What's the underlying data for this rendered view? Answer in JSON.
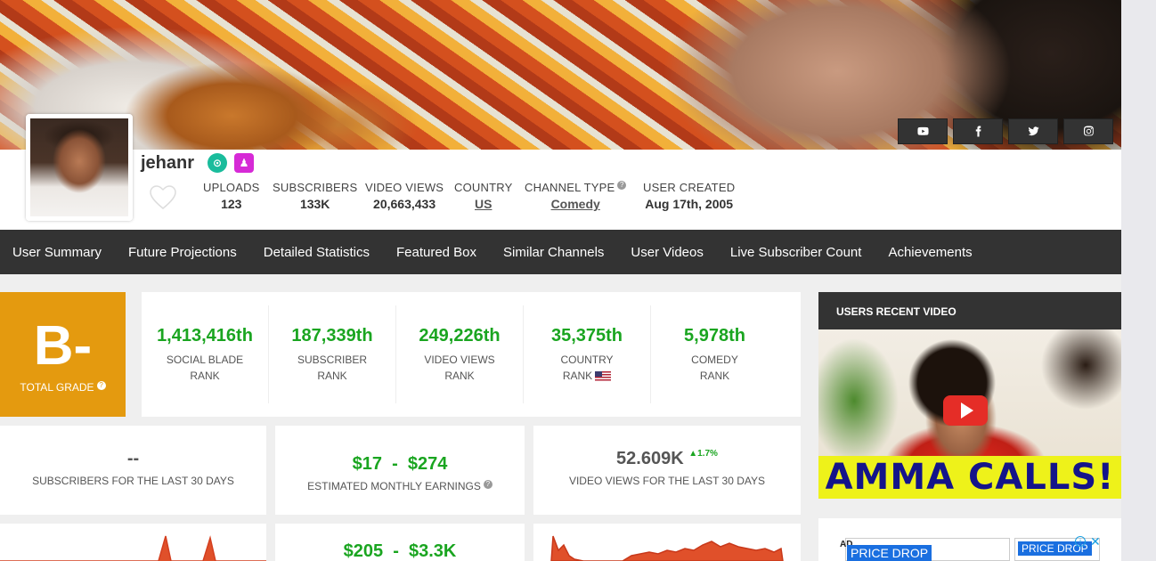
{
  "channel": {
    "username": "jehanr",
    "stats": [
      {
        "label": "UPLOADS",
        "value": "123"
      },
      {
        "label": "SUBSCRIBERS",
        "value": "133K"
      },
      {
        "label": "VIDEO VIEWS",
        "value": "20,663,433"
      },
      {
        "label": "COUNTRY",
        "value": "US"
      },
      {
        "label": "CHANNEL TYPE",
        "value": "Comedy"
      },
      {
        "label": "USER CREATED",
        "value": "Aug 17th, 2005"
      }
    ]
  },
  "social": [
    "youtube-icon",
    "facebook-icon",
    "twitter-icon",
    "instagram-icon"
  ],
  "nav": [
    "User Summary",
    "Future Projections",
    "Detailed Statistics",
    "Featured Box",
    "Similar Channels",
    "User Videos",
    "Live Subscriber Count",
    "Achievements"
  ],
  "grade": {
    "letter": "B-",
    "label": "TOTAL GRADE"
  },
  "ranks": [
    {
      "value": "1,413,416th",
      "line1": "SOCIAL BLADE",
      "line2": "RANK"
    },
    {
      "value": "187,339th",
      "line1": "SUBSCRIBER",
      "line2": "RANK"
    },
    {
      "value": "249,226th",
      "line1": "VIDEO VIEWS",
      "line2": "RANK"
    },
    {
      "value": "35,375th",
      "line1": "COUNTRY",
      "line2": "RANK"
    },
    {
      "value": "5,978th",
      "line1": "COMEDY",
      "line2": "RANK"
    }
  ],
  "cards": {
    "subs30": {
      "value": "--",
      "label": "SUBSCRIBERS FOR THE LAST 30 DAYS"
    },
    "earnings": {
      "value": "$17  -  $274",
      "label": "ESTIMATED MONTHLY EARNINGS"
    },
    "views30": {
      "value": "52.609K",
      "delta": "1.7%",
      "label": "VIDEO VIEWS FOR THE LAST 30 DAYS"
    },
    "yearly": {
      "value": "$205  -  $3.3K"
    }
  },
  "recent_video": {
    "header": "USERS RECENT VIDEO",
    "caption": "AMMA CALLS!"
  },
  "ad": {
    "tag": "AD",
    "pill1": "PRICE DROP",
    "pill2": "PRICE DROP",
    "info": "i",
    "close": "✕"
  },
  "colors": {
    "accent_green": "#1aa520",
    "grade_orange": "#e49a0f",
    "nav_dark": "#333333",
    "chart_red": "#e0502a"
  }
}
